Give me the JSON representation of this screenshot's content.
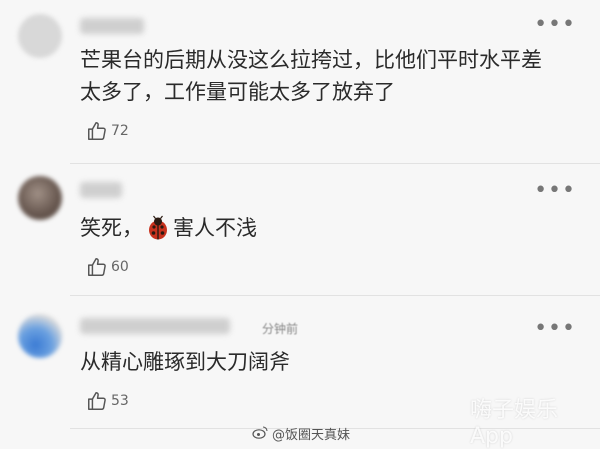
{
  "comments": [
    {
      "text_line1": "芒果台的后期从没这么拉挎过，比他们平时水平差",
      "text_line2": "太多了，工作量可能太多了放弃了",
      "likes": "72",
      "more": "•••"
    },
    {
      "text_before": "笑死，",
      "emoji": "ladybug-emoji",
      "text_after": "害人不浅",
      "likes": "60",
      "more": "•••"
    },
    {
      "time": "分钟前",
      "text": "从精心雕琢到大刀阔斧",
      "likes": "53",
      "more": "•••"
    }
  ],
  "watermarks": {
    "app": "嗨子娱乐App",
    "weibo_icon": "weibo-icon",
    "weibo_handle": "@饭圈天真妹"
  },
  "colors": {
    "background": "#f7f7f7",
    "text": "#2a2a2a",
    "muted": "#666666"
  }
}
